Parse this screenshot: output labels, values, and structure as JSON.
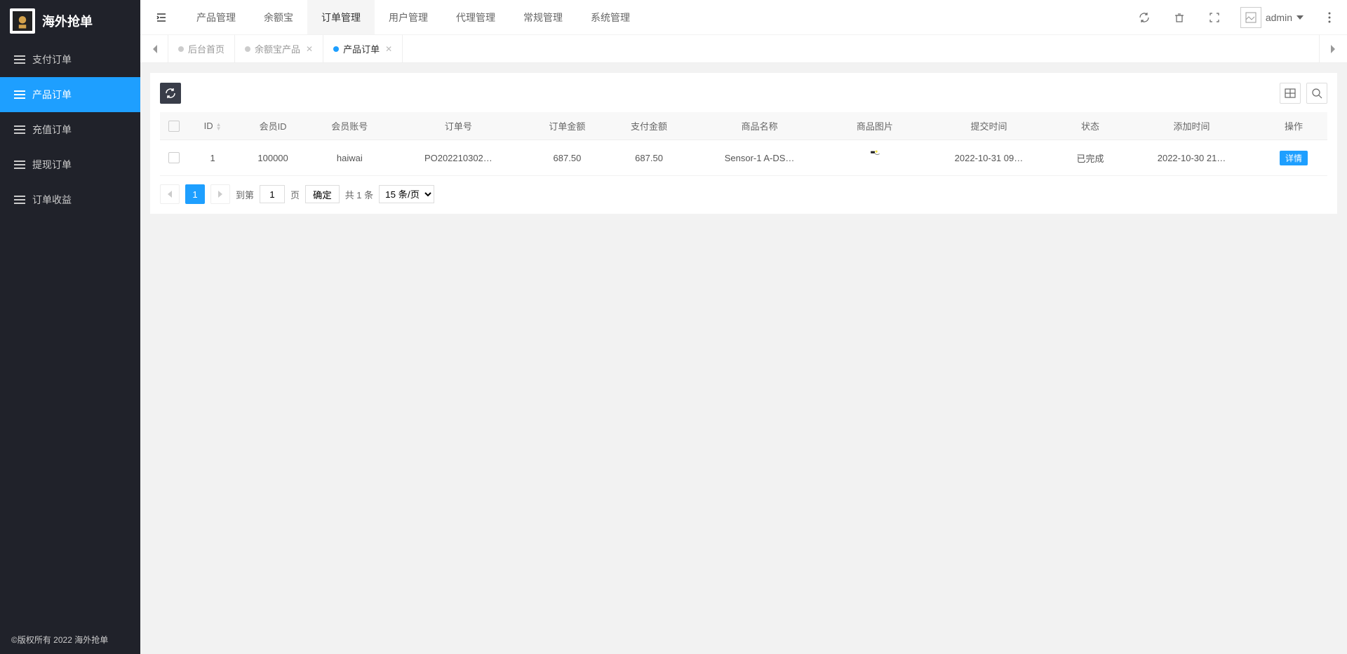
{
  "app": {
    "title": "海外抢单",
    "footer": "©版权所有 2022 海外抢单"
  },
  "sidebar": {
    "items": [
      {
        "label": "支付订单"
      },
      {
        "label": "产品订单"
      },
      {
        "label": "充值订单"
      },
      {
        "label": "提现订单"
      },
      {
        "label": "订单收益"
      }
    ]
  },
  "top_nav": {
    "items": [
      {
        "label": "产品管理"
      },
      {
        "label": "余额宝"
      },
      {
        "label": "订单管理"
      },
      {
        "label": "用户管理"
      },
      {
        "label": "代理管理"
      },
      {
        "label": "常规管理"
      },
      {
        "label": "系统管理"
      }
    ]
  },
  "header": {
    "username": "admin"
  },
  "tabs": {
    "items": [
      {
        "label": "后台首页",
        "closable": false
      },
      {
        "label": "余额宝产品",
        "closable": true
      },
      {
        "label": "产品订单",
        "closable": true
      }
    ]
  },
  "table": {
    "headers": {
      "id": "ID",
      "member_id": "会员ID",
      "member_account": "会员账号",
      "order_no": "订单号",
      "order_amount": "订单金额",
      "pay_amount": "支付金额",
      "product_name": "商品名称",
      "product_image": "商品图片",
      "submit_time": "提交时间",
      "status": "状态",
      "add_time": "添加时间",
      "action": "操作"
    },
    "rows": [
      {
        "id": "1",
        "member_id": "100000",
        "member_account": "haiwai",
        "order_no": "PO202210302…",
        "order_amount": "687.50",
        "pay_amount": "687.50",
        "product_name": "Sensor-1 A-DS…",
        "submit_time": "2022-10-31 09…",
        "status": "已完成",
        "add_time": "2022-10-30 21…",
        "action_label": "详情"
      }
    ]
  },
  "pagination": {
    "current_page": "1",
    "goto_label_prefix": "到第",
    "goto_value": "1",
    "goto_label_suffix": "页",
    "confirm_label": "确定",
    "total_label": "共 1 条",
    "per_page_label": "15 条/页"
  }
}
